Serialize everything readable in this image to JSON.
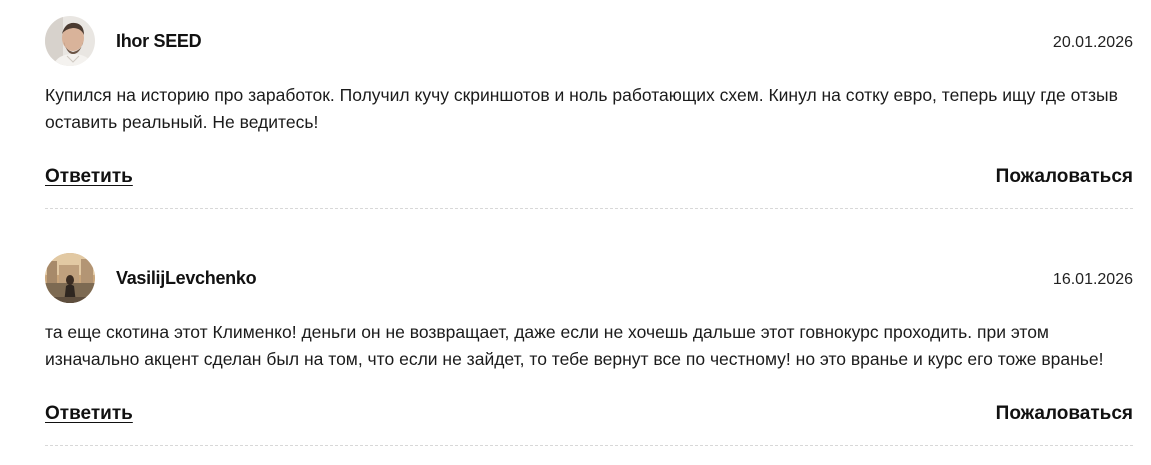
{
  "comments": [
    {
      "author": "Ihor SEED",
      "date": "20.01.2026",
      "text": "Купился на историю про заработок. Получил кучу скриншотов и ноль работающих схем. Кинул на сотку евро, теперь ищу где отзыв оставить реальный. Не ведитесь!",
      "reply_label": "Ответить",
      "report_label": "Пожаловаться"
    },
    {
      "author": "VasilijLevchenko",
      "date": "16.01.2026",
      "text": "та еще скотина этот Клименко! деньги он не возвращает, даже если не хочешь дальше этот говнокурс проходить. при этом изначально акцент сделан был на том, что если не зайдет, то тебе вернут все по честному! но это вранье и курс его тоже вранье!",
      "reply_label": "Ответить",
      "report_label": "Пожаловаться"
    }
  ]
}
